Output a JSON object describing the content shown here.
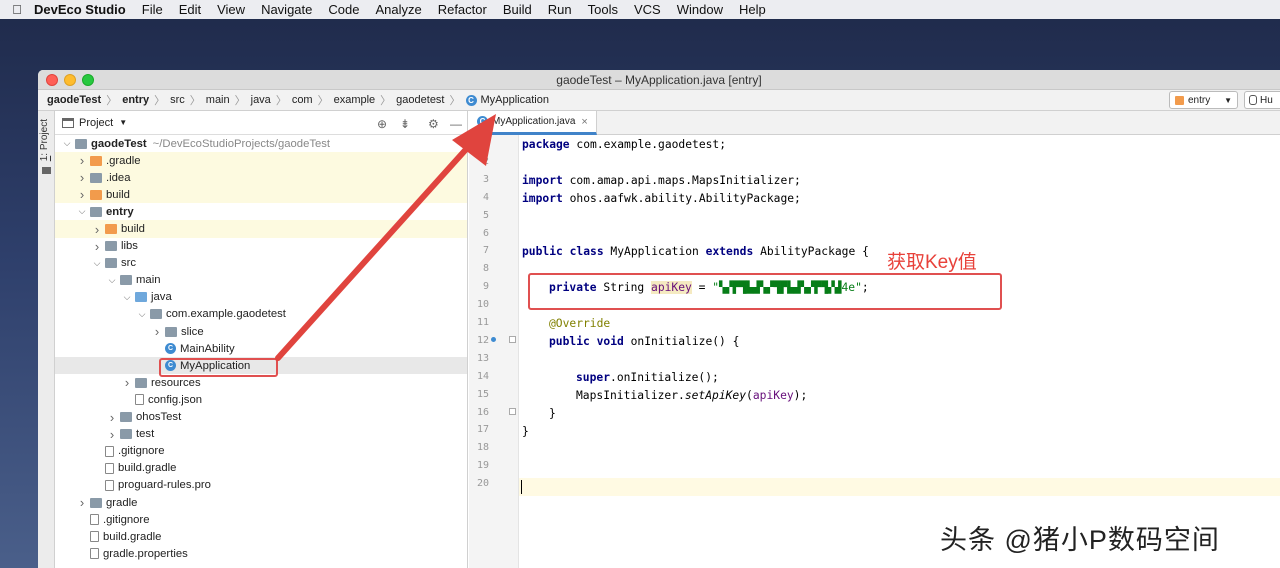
{
  "menubar": {
    "app": "DevEco Studio",
    "items": [
      "File",
      "Edit",
      "View",
      "Navigate",
      "Code",
      "Analyze",
      "Refactor",
      "Build",
      "Run",
      "Tools",
      "VCS",
      "Window",
      "Help"
    ]
  },
  "window": {
    "title": "gaodeTest – MyApplication.java [entry]"
  },
  "breadcrumb": [
    "gaodeTest",
    "entry",
    "src",
    "main",
    "java",
    "com",
    "example",
    "gaodetest",
    "MyApplication"
  ],
  "run_config": {
    "label": "entry",
    "device": "Hu"
  },
  "sidestrip": {
    "num": "1",
    "label": ": Project"
  },
  "project_panel": {
    "title": "Project",
    "tree": [
      {
        "name": "gaodeTest",
        "path": "~/DevEcoStudioProjects/gaodeTest",
        "depth": 0,
        "arrow": "down",
        "icon": "gray",
        "bold": true,
        "hl": false
      },
      {
        "name": ".gradle",
        "depth": 1,
        "arrow": "right",
        "icon": "orange",
        "hl": true
      },
      {
        "name": ".idea",
        "depth": 1,
        "arrow": "right",
        "icon": "gray",
        "hl": true
      },
      {
        "name": "build",
        "depth": 1,
        "arrow": "right",
        "icon": "orange",
        "hl": true
      },
      {
        "name": "entry",
        "depth": 1,
        "arrow": "down",
        "icon": "gray",
        "bold": true,
        "hl": false
      },
      {
        "name": "build",
        "depth": 2,
        "arrow": "right",
        "icon": "orange",
        "hl": true
      },
      {
        "name": "libs",
        "depth": 2,
        "arrow": "right",
        "icon": "gray",
        "hl": false
      },
      {
        "name": "src",
        "depth": 2,
        "arrow": "down",
        "icon": "gray",
        "hl": false
      },
      {
        "name": "main",
        "depth": 3,
        "arrow": "down",
        "icon": "gray",
        "hl": false
      },
      {
        "name": "java",
        "depth": 4,
        "arrow": "down",
        "icon": "blue",
        "hl": false
      },
      {
        "name": "com.example.gaodetest",
        "depth": 5,
        "arrow": "down",
        "icon": "gray",
        "hl": false
      },
      {
        "name": "slice",
        "depth": 6,
        "arrow": "right",
        "icon": "gray",
        "hl": false
      },
      {
        "name": "MainAbility",
        "depth": 6,
        "arrow": "",
        "icon": "class",
        "hl": false
      },
      {
        "name": "MyApplication",
        "depth": 6,
        "arrow": "",
        "icon": "class",
        "hl": false,
        "sel": true
      },
      {
        "name": "resources",
        "depth": 4,
        "arrow": "right",
        "icon": "gray",
        "hl": false
      },
      {
        "name": "config.json",
        "depth": 4,
        "arrow": "",
        "icon": "file",
        "hl": false
      },
      {
        "name": "ohosTest",
        "depth": 3,
        "arrow": "right",
        "icon": "gray",
        "hl": false
      },
      {
        "name": "test",
        "depth": 3,
        "arrow": "right",
        "icon": "gray",
        "hl": false
      },
      {
        "name": ".gitignore",
        "depth": 2,
        "arrow": "",
        "icon": "file",
        "hl": false
      },
      {
        "name": "build.gradle",
        "depth": 2,
        "arrow": "",
        "icon": "file",
        "hl": false
      },
      {
        "name": "proguard-rules.pro",
        "depth": 2,
        "arrow": "",
        "icon": "file",
        "hl": false
      },
      {
        "name": "gradle",
        "depth": 1,
        "arrow": "right",
        "icon": "gray",
        "hl": false
      },
      {
        "name": ".gitignore",
        "depth": 1,
        "arrow": "",
        "icon": "file",
        "hl": false
      },
      {
        "name": "build.gradle",
        "depth": 1,
        "arrow": "",
        "icon": "file",
        "hl": false
      },
      {
        "name": "gradle.properties",
        "depth": 1,
        "arrow": "",
        "icon": "file",
        "hl": false
      }
    ]
  },
  "editor": {
    "tab": "MyApplication.java",
    "line_numbers": [
      "1",
      "2",
      "3",
      "4",
      "5",
      "6",
      "7",
      "8",
      "9",
      "10",
      "11",
      "12",
      "13",
      "14",
      "15",
      "16",
      "17",
      "18",
      "19",
      "20"
    ],
    "lines": {
      "l1": {
        "kw": "package",
        "rest": " com.example.gaodetest;"
      },
      "l3": {
        "kw": "import",
        "rest": " com.amap.api.maps.MapsInitializer;"
      },
      "l4": {
        "kw": "import",
        "rest": " ohos.aafwk.ability.AbilityPackage;"
      },
      "l7": {
        "kw1": "public class",
        "mid": " MyApplication ",
        "kw2": "extends",
        "rest": " AbilityPackage {"
      },
      "l9": {
        "kw": "private",
        "type": " String ",
        "field": "apiKey",
        "eq": " = ",
        "str": "\"▚▞▛▜▙▟▚▞▜▛▙▟▚▞▛▜▞▟4e\"",
        "end": ";"
      },
      "l11": {
        "ann": "@Override"
      },
      "l12": {
        "kw": "public void",
        "rest": " onInitialize() {"
      },
      "l14": {
        "kw": "super",
        "rest": ".onInitialize();"
      },
      "l15": {
        "cls": "MapsInitializer.",
        "method": "setApiKey",
        "open": "(",
        "field": "apiKey",
        "close": ");"
      },
      "l16": {
        "text": "}"
      },
      "l17": {
        "text": "}"
      }
    }
  },
  "annotation": {
    "label": "获取Key值",
    "color": "#e8413a"
  },
  "watermark": "头条 @猪小P数码空间"
}
